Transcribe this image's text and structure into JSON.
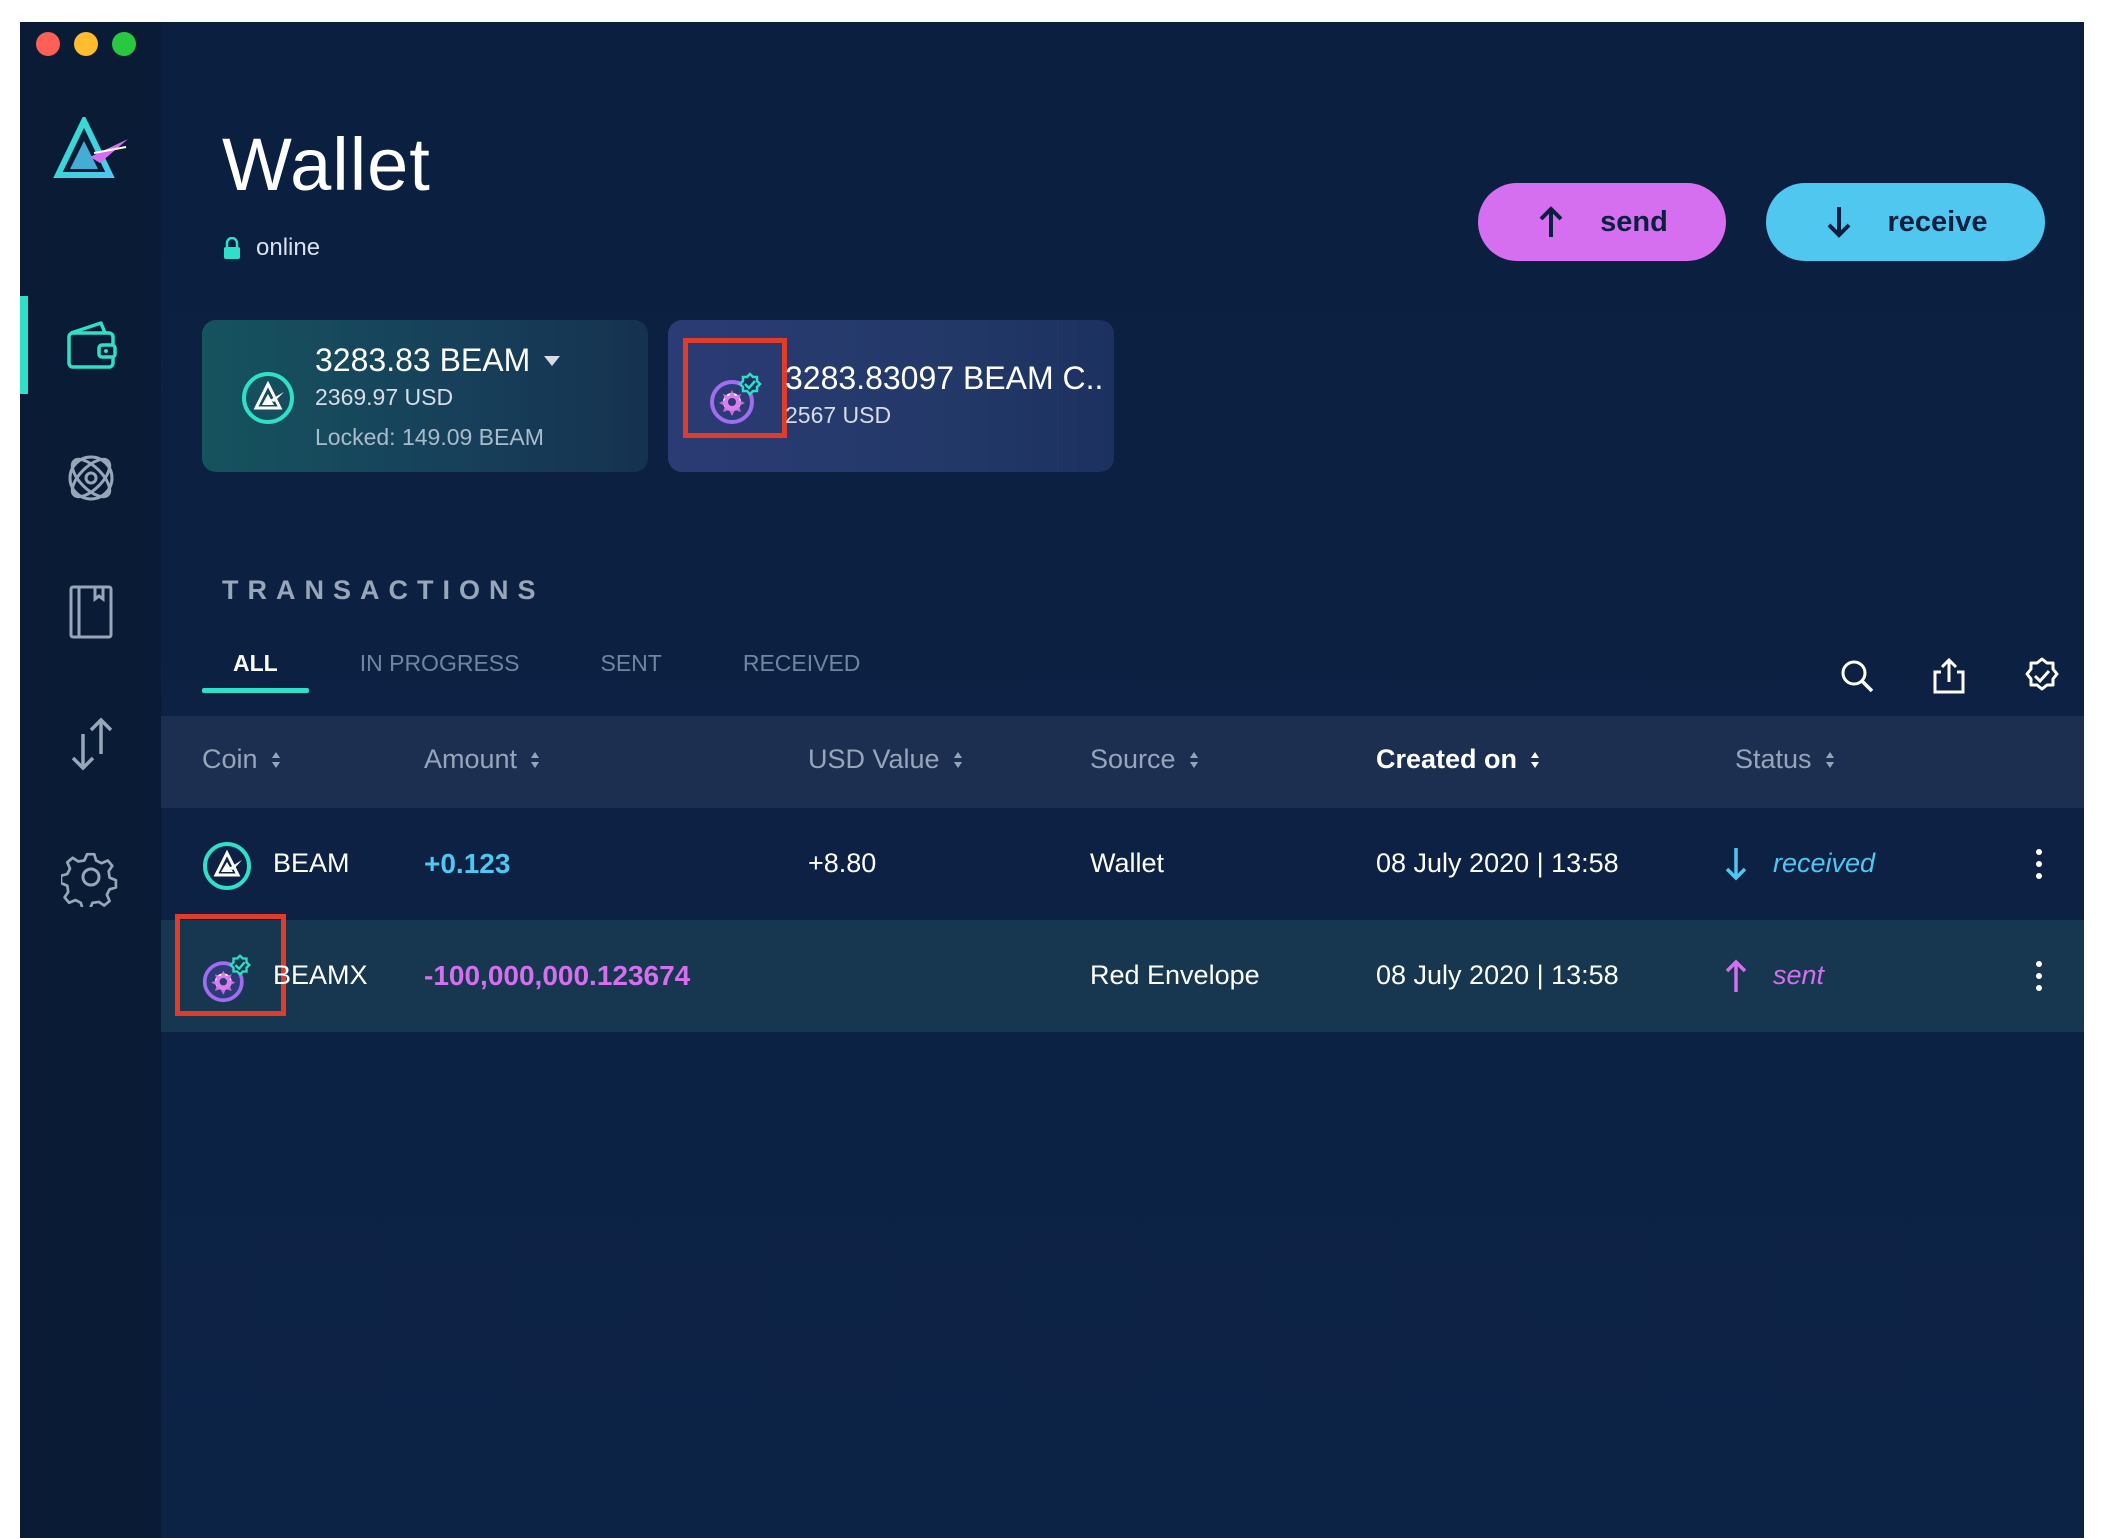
{
  "window": {
    "traffic_lights": [
      "close",
      "minimize",
      "zoom"
    ]
  },
  "sidebar": {
    "items": [
      {
        "name": "wallet",
        "icon": "wallet-icon",
        "active": true
      },
      {
        "name": "atomic-swap",
        "icon": "atom-icon",
        "active": false
      },
      {
        "name": "address-book",
        "icon": "book-icon",
        "active": false
      },
      {
        "name": "utxo",
        "icon": "transfer-arrows-icon",
        "active": false
      },
      {
        "name": "settings",
        "icon": "gear-icon",
        "active": false
      }
    ]
  },
  "header": {
    "title": "Wallet",
    "status": "online"
  },
  "actions": {
    "send_label": "send",
    "receive_label": "receive"
  },
  "assets": {
    "beam": {
      "amount": "3283.83 BEAM",
      "usd": "2369.97 USD",
      "locked": "Locked: 149.09 BEAM"
    },
    "beamx": {
      "amount": "3283.83097 BEAM C..",
      "usd": "2567 USD"
    }
  },
  "transactions": {
    "title": "TRANSACTIONS",
    "tabs": [
      "ALL",
      "IN PROGRESS",
      "SENT",
      "RECEIVED"
    ],
    "active_tab": "ALL",
    "columns": [
      "Coin",
      "Amount",
      "USD Value",
      "Source",
      "Created on",
      "Status"
    ],
    "sorted_column": "Created on",
    "rows": [
      {
        "coin": "BEAM",
        "amount": "+0.123",
        "usd_value": "+8.80",
        "source": "Wallet",
        "created_on": "08 July 2020  | 13:58",
        "status": "received",
        "direction": "in"
      },
      {
        "coin": "BEAMX",
        "amount": "-100,000,000.123674",
        "usd_value": "",
        "source": "Red Envelope",
        "created_on": "08 July 2020  | 13:58",
        "status": "sent",
        "direction": "out"
      }
    ]
  },
  "colors": {
    "accent_teal": "#2ee0c7",
    "send_purple": "#d56ff0",
    "receive_blue": "#4fc7ef",
    "background": "#0d2143",
    "highlight_red": "#e03c2a"
  }
}
